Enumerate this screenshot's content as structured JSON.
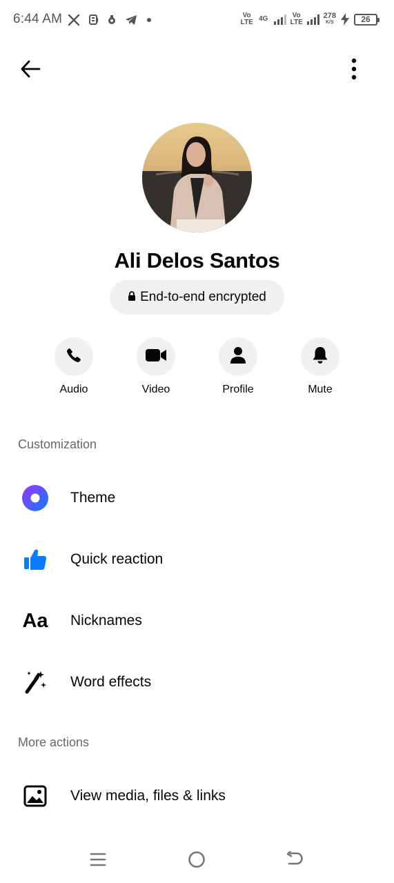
{
  "status_bar": {
    "time": "6:44 AM",
    "left_icons": [
      "x-icon",
      "message-app-icon",
      "notification-icon",
      "telegram-icon",
      "dot-icon"
    ],
    "volte1": "Vo LTE",
    "net1": "4G",
    "volte2": "Vo LTE",
    "net_speed": "278",
    "net_speed_unit": "K/S",
    "battery": "26"
  },
  "header": {
    "back_icon": "arrow-left-icon",
    "menu_icon": "kebab-menu-icon"
  },
  "profile": {
    "name": "Ali Delos Santos",
    "encryption_label": "End-to-end encrypted"
  },
  "actions": [
    {
      "label": "Audio",
      "icon": "phone-icon"
    },
    {
      "label": "Video",
      "icon": "video-camera-icon"
    },
    {
      "label": "Profile",
      "icon": "person-icon"
    },
    {
      "label": "Mute",
      "icon": "bell-icon"
    }
  ],
  "sections": {
    "customization": {
      "title": "Customization",
      "items": [
        {
          "label": "Theme",
          "icon": "theme-icon"
        },
        {
          "label": "Quick reaction",
          "icon": "thumbs-up-icon"
        },
        {
          "label": "Nicknames",
          "icon": "nickname-aa-icon"
        },
        {
          "label": "Word effects",
          "icon": "magic-wand-icon"
        }
      ]
    },
    "more_actions": {
      "title": "More actions",
      "items": [
        {
          "label": "View media, files & links",
          "icon": "image-icon"
        }
      ]
    }
  },
  "nickname_glyph": "Aa",
  "colors": {
    "accent_blue": "#0a7cff",
    "theme_gradient_start": "#a033ff",
    "theme_gradient_end": "#0a7cff",
    "secondary_text": "#65676b",
    "pill_bg": "#f0f0f0"
  }
}
